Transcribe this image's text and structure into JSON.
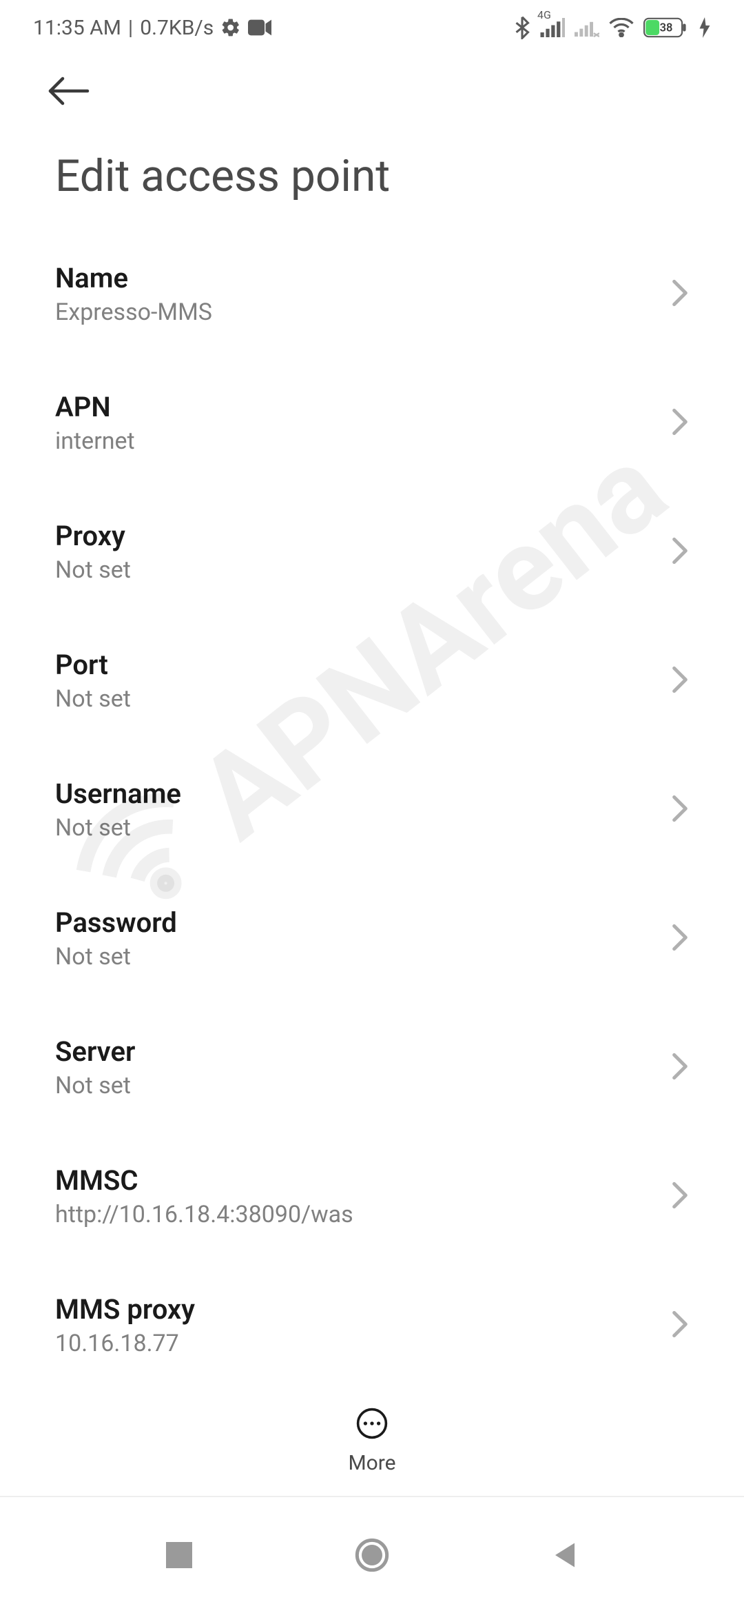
{
  "status_bar": {
    "time": "11:35 AM",
    "separator": " | ",
    "speed": "0.7KB/s",
    "network_label": "4G",
    "battery_percent": "38"
  },
  "header": {
    "title": "Edit access point"
  },
  "settings": [
    {
      "label": "Name",
      "value": "Expresso-MMS"
    },
    {
      "label": "APN",
      "value": "internet"
    },
    {
      "label": "Proxy",
      "value": "Not set"
    },
    {
      "label": "Port",
      "value": "Not set"
    },
    {
      "label": "Username",
      "value": "Not set"
    },
    {
      "label": "Password",
      "value": "Not set"
    },
    {
      "label": "Server",
      "value": "Not set"
    },
    {
      "label": "MMSC",
      "value": "http://10.16.18.4:38090/was"
    },
    {
      "label": "MMS proxy",
      "value": "10.16.18.77"
    }
  ],
  "footer": {
    "more_label": "More"
  },
  "watermark": {
    "text": "APNArena"
  }
}
